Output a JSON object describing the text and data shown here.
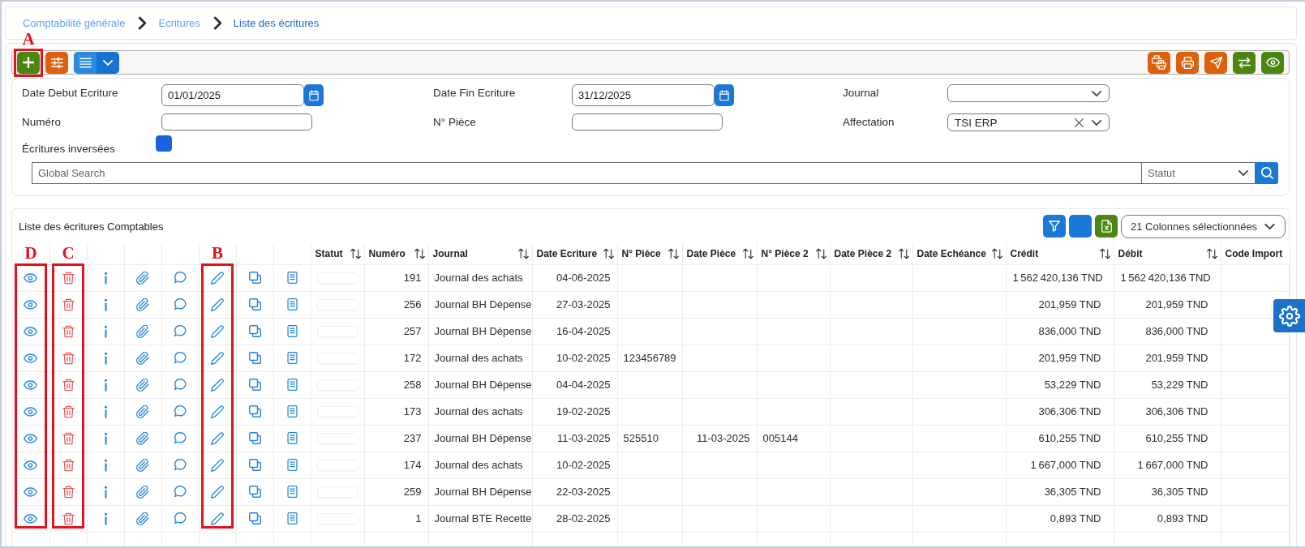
{
  "breadcrumb": [
    {
      "label": "Comptabilité générale",
      "current": false
    },
    {
      "label": "Ecritures",
      "current": false
    },
    {
      "label": "Liste des écritures",
      "current": true
    }
  ],
  "toolbar": {
    "left": [
      {
        "kind": "add",
        "callout": "A"
      },
      {
        "kind": "sliders"
      },
      {
        "kind": "list-menu"
      }
    ],
    "right": [
      {
        "kind": "batch-print"
      },
      {
        "kind": "print"
      },
      {
        "kind": "send"
      },
      {
        "kind": "swap"
      },
      {
        "kind": "preview"
      }
    ]
  },
  "filters": {
    "fields": [
      {
        "kind": "date",
        "label": "Date Debut Ecriture",
        "value": "01/01/2025"
      },
      {
        "kind": "date",
        "label": "Date Fin Ecriture",
        "value": "31/12/2025"
      },
      {
        "kind": "select",
        "label": "Journal"
      },
      {
        "kind": "text",
        "label": "Numéro"
      },
      {
        "kind": "text",
        "label": "N° Pièce"
      },
      {
        "kind": "select",
        "label": "Affectation",
        "value": "TSI ERP"
      },
      {
        "kind": "checkbox",
        "label": "Écritures inversées",
        "checked": true
      }
    ],
    "search": {
      "placeholder": "Global Search"
    },
    "status_select": {
      "placeholder": "Statut"
    }
  },
  "table": {
    "title": "Liste des écritures Comptables",
    "tools": [
      {
        "kind": "filter"
      },
      {
        "kind": "blank"
      },
      {
        "kind": "excel"
      }
    ],
    "column_picker": {
      "value": "21 Colonnes sélectionnées"
    },
    "row_actions": [
      {
        "kind": "view",
        "callout": "D"
      },
      {
        "kind": "delete",
        "callout": "C"
      },
      {
        "kind": "info"
      },
      {
        "kind": "attach"
      },
      {
        "kind": "comment"
      },
      {
        "kind": "edit",
        "callout": "B"
      },
      {
        "kind": "copy"
      },
      {
        "kind": "details"
      }
    ],
    "columns": [
      {
        "label": "Statut",
        "kind": "status",
        "sortable": true
      },
      {
        "label": "Numéro",
        "kind": "number",
        "sortable": true
      },
      {
        "label": "Journal",
        "kind": "text",
        "sortable": true
      },
      {
        "label": "Date Ecriture",
        "kind": "date",
        "sortable": true
      },
      {
        "label": "N° Pièce",
        "kind": "text",
        "sortable": true
      },
      {
        "label": "Date Pièce",
        "kind": "date",
        "sortable": true
      },
      {
        "label": "N° Pièce 2",
        "kind": "text",
        "sortable": true
      },
      {
        "label": "Date Pièce 2",
        "kind": "date",
        "sortable": true
      },
      {
        "label": "Date Echéance",
        "kind": "date",
        "sortable": true
      },
      {
        "label": "Crédit",
        "kind": "amount",
        "sortable": true
      },
      {
        "label": "Débit",
        "kind": "amount",
        "sortable": true
      },
      {
        "label": "Code Import",
        "kind": "text",
        "sortable": false
      }
    ],
    "rows": [
      [
        null,
        "191",
        "Journal des achats",
        "04-06-2025",
        null,
        null,
        null,
        null,
        null,
        "1 562 420,136 TND",
        "1 562 420,136 TND",
        null
      ],
      [
        null,
        "256",
        "Journal BH Dépense",
        "27-03-2025",
        null,
        null,
        null,
        null,
        null,
        "201,959 TND",
        "201,959 TND",
        null
      ],
      [
        null,
        "257",
        "Journal BH Dépense",
        "16-04-2025",
        null,
        null,
        null,
        null,
        null,
        "836,000 TND",
        "836,000 TND",
        null
      ],
      [
        null,
        "172",
        "Journal des achats",
        "10-02-2025",
        "123456789",
        null,
        null,
        null,
        null,
        "201,959 TND",
        "201,959 TND",
        null
      ],
      [
        null,
        "258",
        "Journal BH Dépense",
        "04-04-2025",
        null,
        null,
        null,
        null,
        null,
        "53,229 TND",
        "53,229 TND",
        null
      ],
      [
        null,
        "173",
        "Journal des achats",
        "19-02-2025",
        null,
        null,
        null,
        null,
        null,
        "306,306 TND",
        "306,306 TND",
        null
      ],
      [
        null,
        "237",
        "Journal BH Dépense",
        "11-03-2025",
        "525510",
        "11-03-2025",
        "005144",
        null,
        null,
        "610,255 TND",
        "610,255 TND",
        null
      ],
      [
        null,
        "174",
        "Journal des achats",
        "10-02-2025",
        null,
        null,
        null,
        null,
        null,
        "1 667,000 TND",
        "1 667,000 TND",
        null
      ],
      [
        null,
        "259",
        "Journal BH Dépense",
        "22-03-2025",
        null,
        null,
        null,
        null,
        null,
        "36,305 TND",
        "36,305 TND",
        null
      ],
      [
        null,
        "1",
        "Journal BTE Recette",
        "28-02-2025",
        null,
        null,
        null,
        null,
        null,
        "0,893 TND",
        "0,893 TND",
        null
      ]
    ]
  }
}
